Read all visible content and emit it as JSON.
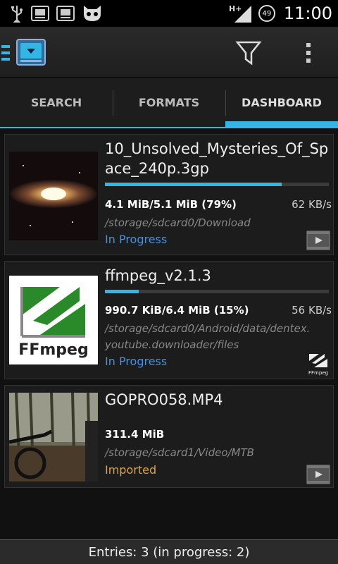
{
  "status_bar": {
    "time": "11:00",
    "battery": "49",
    "network": "H+",
    "icons": [
      "usb-icon",
      "download-icon",
      "download-icon",
      "cyanogen-mascot-icon",
      "signal-icon",
      "battery-icon"
    ]
  },
  "action_bar": {
    "icons": [
      "app-logo-icon",
      "filter-icon",
      "overflow-menu-icon"
    ]
  },
  "tabs": [
    {
      "label": "SEARCH",
      "active": false
    },
    {
      "label": "FORMATS",
      "active": false
    },
    {
      "label": "DASHBOARD",
      "active": true
    }
  ],
  "downloads": [
    {
      "title": "10_Unsolved_Mysteries_Of_Space_240p.3gp",
      "progress_fraction": 0.79,
      "size": "4.1 MiB/5.1 MiB (79%)",
      "speed": "62 KB/s",
      "path": "/storage/sdcard0/Download",
      "state": "In Progress",
      "type_icon": "video-icon"
    },
    {
      "title": "ffmpeg_v2.1.3",
      "progress_fraction": 0.15,
      "size": "990.7 KiB/6.4 MiB (15%)",
      "speed": "56 KB/s",
      "path": "/storage/sdcard0/Android/data/dentex.youtube.downloader/files",
      "state": "In Progress",
      "type_icon": "ffmpeg-icon",
      "type_icon_label": "FFmpeg"
    },
    {
      "title": "GOPRO058.MP4",
      "size": "311.4 MiB",
      "path": "/storage/sdcard1/Video/MTB",
      "state": "Imported",
      "type_icon": "video-icon"
    }
  ],
  "thumbnail_labels": {
    "ffmpeg": "FFmpeg"
  },
  "footer": {
    "entries": "Entries: 3 (in progress: 2)"
  },
  "colors": {
    "accent": "#33b5e5",
    "in_progress": "#4a90d9",
    "imported": "#e0a040"
  }
}
